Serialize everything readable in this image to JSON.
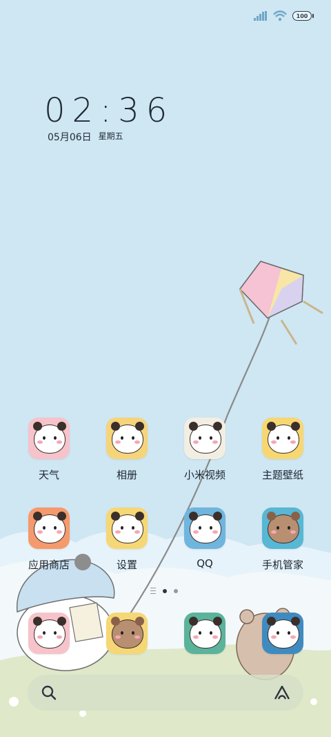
{
  "status_bar": {
    "battery_label": "100",
    "signal_icon": "signal-icon",
    "wifi_icon": "wifi-icon"
  },
  "clock": {
    "time": "02:36",
    "date": "05月06日",
    "weekday": "星期五"
  },
  "apps_row1": [
    {
      "label": "天气",
      "bg": "#f6c3cb"
    },
    {
      "label": "相册",
      "bg": "#f6d47a"
    },
    {
      "label": "小米视频",
      "bg": "#f3eee2"
    },
    {
      "label": "主题壁纸",
      "bg": "#f7d772"
    }
  ],
  "apps_row2": [
    {
      "label": "应用商店",
      "bg": "#f59a6c"
    },
    {
      "label": "设置",
      "bg": "#f6d775"
    },
    {
      "label": "QQ",
      "bg": "#6fb5de"
    },
    {
      "label": "手机管家",
      "bg": "#57b7d4"
    }
  ],
  "dock": [
    {
      "bg": "#f6c3cb"
    },
    {
      "bg": "#f6d775"
    },
    {
      "bg": "#5ab39a"
    },
    {
      "bg": "#3f8bc0"
    }
  ],
  "pager": {
    "pages": 2,
    "active": 1
  },
  "search": {
    "search_icon": "search-icon",
    "assistant_icon": "assistant-icon"
  },
  "colors": {
    "sky": "#cfe6f3",
    "text": "#1d2630"
  }
}
